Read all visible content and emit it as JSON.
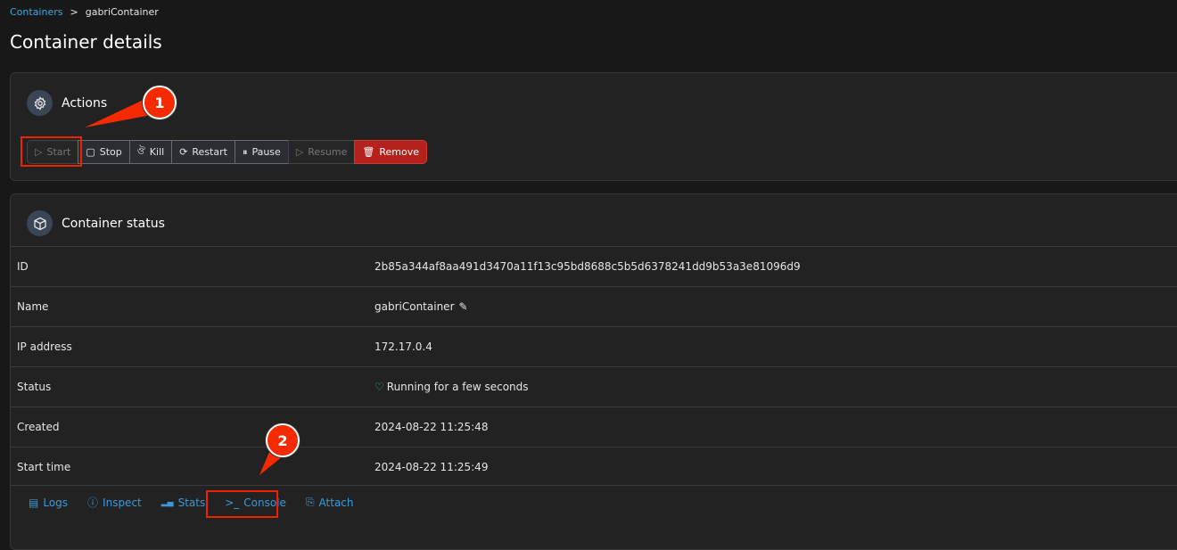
{
  "breadcrumb": {
    "link": "Containers",
    "separator": ">",
    "current": "gabriContainer"
  },
  "page_title": "Container details",
  "actions": {
    "title": "Actions",
    "icon": "gear-icon",
    "buttons": [
      {
        "label": "Start",
        "icon": "play-icon",
        "disabled": true
      },
      {
        "label": "Stop",
        "icon": "square-icon",
        "disabled": false
      },
      {
        "label": "Kill",
        "icon": "bomb-icon",
        "disabled": false
      },
      {
        "label": "Restart",
        "icon": "refresh-icon",
        "disabled": false
      },
      {
        "label": "Pause",
        "icon": "pause-icon",
        "disabled": false
      },
      {
        "label": "Resume",
        "icon": "play-icon",
        "disabled": true
      },
      {
        "label": "Remove",
        "icon": "trash-icon",
        "disabled": false
      }
    ]
  },
  "status": {
    "title": "Container status",
    "icon": "box-icon",
    "rows": [
      {
        "label": "ID",
        "value": "2b85a344af8aa491d3470a11f13c95bd8688c5b5d6378241dd9b53a3e81096d9"
      },
      {
        "label": "Name",
        "value": "gabriContainer"
      },
      {
        "label": "IP address",
        "value": "172.17.0.4"
      },
      {
        "label": "Status",
        "value": "Running for a few seconds"
      },
      {
        "label": "Created",
        "value": "2024-08-22 11:25:48"
      },
      {
        "label": "Start time",
        "value": "2024-08-22 11:25:49"
      }
    ],
    "links": [
      "Logs",
      "Inspect",
      "Stats",
      "Console",
      "Attach"
    ]
  },
  "annotations": [
    "1",
    "2"
  ],
  "colors": {
    "accent": "#3a9ad9",
    "danger": "#b3221d",
    "running": "#2ecc71",
    "callout": "#f52a00"
  }
}
